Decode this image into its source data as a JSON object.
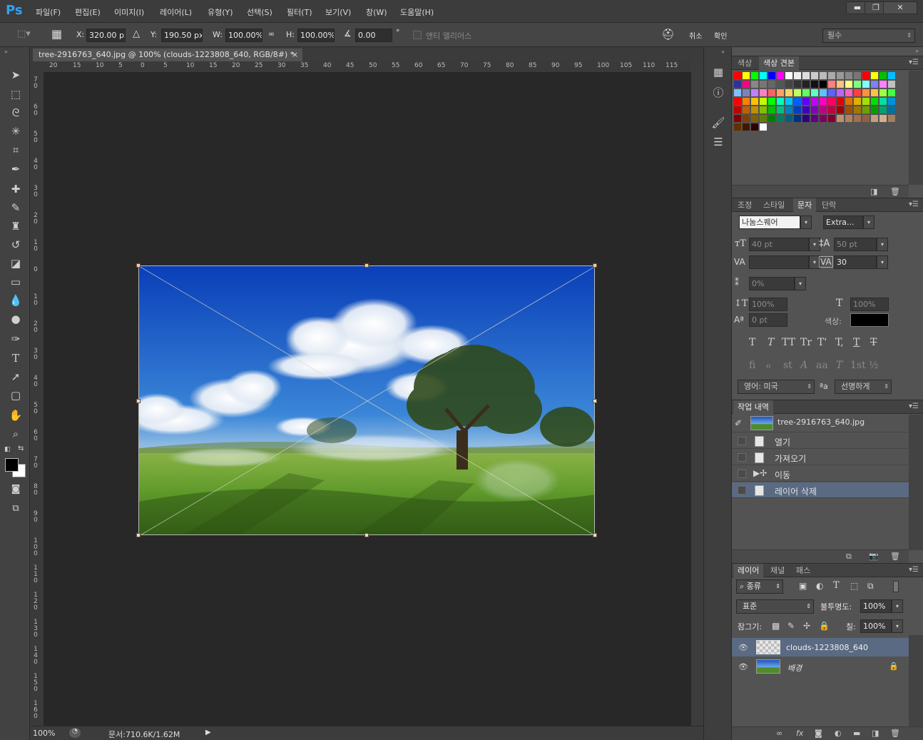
{
  "app": {
    "logo": "Ps"
  },
  "menu": [
    "파일(F)",
    "편집(E)",
    "이미지(I)",
    "레이어(L)",
    "유형(Y)",
    "선택(S)",
    "필터(T)",
    "보기(V)",
    "창(W)",
    "도움말(H)"
  ],
  "window_buttons": [
    "▬",
    "❐",
    "✕"
  ],
  "options": {
    "x_label": "X:",
    "x_value": "320.00 px",
    "y_label": "Y:",
    "y_value": "190.50 px",
    "w_label": "W:",
    "w_value": "100.00%",
    "h_label": "H:",
    "h_value": "100.00%",
    "angle_value": "0.00",
    "degree": "°",
    "antialias_label": "앤티 앨리어스",
    "cancel_label": "취소",
    "confirm_label": "확인",
    "workspace": "필수"
  },
  "document": {
    "tab_title": "tree-2916763_640.jpg @ 100% (clouds-1223808_640, RGB/8#) *",
    "close": "×",
    "zoom": "100%",
    "doc_size": "문서:710.6K/1.62M"
  },
  "ruler_top": [
    "20",
    "15",
    "10",
    "5",
    "0",
    "5",
    "10",
    "15",
    "20",
    "25",
    "30",
    "35",
    "40",
    "45",
    "50",
    "55",
    "60",
    "65",
    "70",
    "75",
    "80",
    "85",
    "90",
    "95",
    "100",
    "105",
    "110",
    "115"
  ],
  "ruler_left": [
    "7 0",
    "6 0",
    "5 0",
    "4 0",
    "3 0",
    "2 0",
    "1 0",
    "0",
    "1 0",
    "2 0",
    "3 0",
    "4 0",
    "5 0",
    "6 0",
    "7 0",
    "8 0",
    "9 0",
    "1 0 0",
    "1 1 0",
    "1 2 0",
    "1 3 0",
    "1 4 0",
    "1 5 0",
    "1 6 0"
  ],
  "tools": {
    "move": "move-tool",
    "marquee": "marquee-tool",
    "lasso": "lasso-tool",
    "magic": "magic-wand-tool",
    "crop": "crop-tool",
    "eyedropper": "eyedropper-tool",
    "healing": "healing-brush-tool",
    "brush": "brush-tool",
    "stamp": "clone-stamp-tool",
    "history_brush": "history-brush-tool",
    "eraser": "eraser-tool",
    "gradient": "gradient-tool",
    "blur": "blur-tool",
    "dodge": "dodge-tool",
    "pen": "pen-tool",
    "type": "type-tool",
    "path_select": "path-selection-tool",
    "shape": "shape-tool",
    "hand": "hand-tool",
    "zoom": "zoom-tool"
  },
  "swatches_panel": {
    "tabs": [
      "색상",
      "색상 견본"
    ],
    "colors": [
      "#ff0000",
      "#ffff00",
      "#00ff00",
      "#00ffff",
      "#0000ff",
      "#ff00ff",
      "#ffffff",
      "#eeeeee",
      "#dddddd",
      "#cccccc",
      "#bbbbbb",
      "#aaaaaa",
      "#999999",
      "#888888",
      "#777777",
      "#ff0000",
      "#ffff00",
      "#00c000",
      "#00c0ff",
      "#3030a0",
      "#ff0080",
      "#888888",
      "#777777",
      "#666666",
      "#555555",
      "#444444",
      "#333333",
      "#222222",
      "#111111",
      "#000000",
      "#ff8080",
      "#ffc080",
      "#ffff80",
      "#80ff80",
      "#80ffff",
      "#8080ff",
      "#ff80ff",
      "#c0c0c0",
      "#80c0ff",
      "#8080c0",
      "#c080ff",
      "#ff80c0",
      "#ff6060",
      "#ffa060",
      "#ffd060",
      "#c0ff60",
      "#60ff60",
      "#60ffc0",
      "#60c0ff",
      "#6060ff",
      "#c060ff",
      "#ff60c0",
      "#ff4040",
      "#ff9040",
      "#ffc040",
      "#a0ff40",
      "#40ff40",
      "#ff0000",
      "#ff8000",
      "#ffc000",
      "#c0ff00",
      "#00ff00",
      "#00ffc0",
      "#00c0ff",
      "#0060ff",
      "#6000ff",
      "#c000ff",
      "#ff00c0",
      "#ff0060",
      "#e00000",
      "#e07000",
      "#e0b000",
      "#a0e000",
      "#00e000",
      "#00e0a0",
      "#0090e0",
      "#c00000",
      "#c06000",
      "#c09000",
      "#80c000",
      "#00c000",
      "#00c080",
      "#0080c0",
      "#0040c0",
      "#4000c0",
      "#8000c0",
      "#c00080",
      "#c00040",
      "#a00000",
      "#a05000",
      "#a07800",
      "#70a000",
      "#00a000",
      "#00a070",
      "#0070a0",
      "#800000",
      "#804000",
      "#806000",
      "#608000",
      "#008000",
      "#008060",
      "#006080",
      "#003080",
      "#300080",
      "#600080",
      "#800060",
      "#800030",
      "#c09070",
      "#b08060",
      "#a07050",
      "#906040",
      "#c0a080",
      "#d0b090",
      "#a08060",
      "#603000",
      "#401800",
      "#300000",
      "#ffffff"
    ]
  },
  "char_panel": {
    "tabs": [
      "조정",
      "스타일",
      "문자",
      "단락"
    ],
    "font_family": "나눔스퀘어",
    "font_style": "Extra...",
    "size": "40 pt",
    "leading": "50 pt",
    "kerning": "",
    "tracking": "30",
    "vscale": "0%",
    "hscale_v": "100%",
    "hscale_h": "100%",
    "baseline": "0 pt",
    "color_label": "색상:",
    "glyphs1": [
      "T",
      "T",
      "TT",
      "Tr",
      "T'",
      "T,",
      "T",
      "T"
    ],
    "glyphs2": [
      "fi",
      "ℴ",
      "st",
      "A",
      "aa",
      "T",
      "1st",
      "½"
    ],
    "language": "영어: 미국",
    "aa_icon": "ªa",
    "aa_mode": "선명하게"
  },
  "history_panel": {
    "tab": "작업 내역",
    "snapshot": "tree-2916763_640.jpg",
    "items": [
      "열기",
      "가져오기",
      "이동",
      "레이어 삭제"
    ]
  },
  "layers_panel": {
    "tabs": [
      "레이어",
      "채널",
      "패스"
    ],
    "filter": "종류",
    "blend_mode": "표준",
    "opacity_label": "불투명도:",
    "opacity": "100%",
    "lock_label": "잠그기:",
    "fill_label": "칠:",
    "fill": "100%",
    "layers": [
      {
        "name": "clouds-1223808_640",
        "selected": true
      },
      {
        "name": "배경",
        "selected": false
      }
    ]
  }
}
